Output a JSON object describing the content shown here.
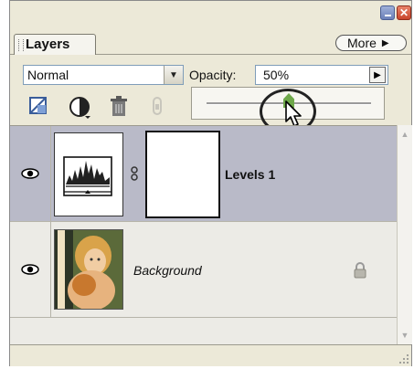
{
  "panel": {
    "tab_label": "Layers",
    "more_label": "More"
  },
  "window_buttons": {
    "minimize": "minimize-icon",
    "close": "close-icon"
  },
  "blend_mode": {
    "value": "Normal"
  },
  "opacity": {
    "label": "Opacity:",
    "value": "50%",
    "slider_fraction": 0.5
  },
  "toolbar_icons": [
    "lock-transparent-pixels-icon",
    "lock-image-pixels-icon",
    "trash-lock-icon",
    "lock-position-icon"
  ],
  "layers": [
    {
      "name": "Levels 1",
      "visible": true,
      "selected": true,
      "type": "adjustment",
      "icon": "levels-histogram-icon"
    },
    {
      "name": "Background",
      "visible": true,
      "selected": false,
      "type": "image",
      "icon": "lock-icon"
    }
  ],
  "colors": {
    "selected_row": "#b9bac8",
    "panel_bg": "#ece9d8"
  }
}
